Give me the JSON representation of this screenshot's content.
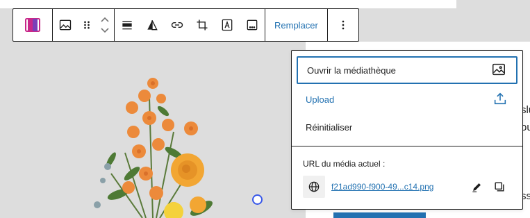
{
  "toolbar": {
    "block_icon": "cover-block-icon",
    "transform_icon": "image-icon",
    "drag_icon": "drag-handle-icon",
    "move_up_icon": "chevron-up-icon",
    "move_down_icon": "chevron-down-icon",
    "align_icon": "align-full-width-icon",
    "duotone_icon": "duotone-filter-icon",
    "link_icon": "link-icon",
    "crop_icon": "crop-icon",
    "text_icon": "text-overlay-icon",
    "alt_icon": "more-horizontal-icon",
    "replace_label": "Remplacer",
    "options_icon": "more-vertical-icon"
  },
  "popover": {
    "items": [
      {
        "label": "Ouvrir la médiathèque",
        "icon": "image-icon"
      },
      {
        "label": "Upload",
        "icon": "upload-icon"
      },
      {
        "label": "Réinitialiser"
      }
    ],
    "current_media_label": "URL du média actuel :",
    "current_media_url": "f21ad990-f900-49...c14.png",
    "globe_icon": "globe-icon",
    "edit_icon": "pencil-icon",
    "copy_icon": "copy-icon"
  },
  "background_text": {
    "line1": "slu",
    "line2": "ou",
    "line3": "ss"
  },
  "colors": {
    "accent": "#2271b1",
    "border": "#1e1e1e",
    "canvas": "#dddddd",
    "handle": "#3858e9"
  }
}
